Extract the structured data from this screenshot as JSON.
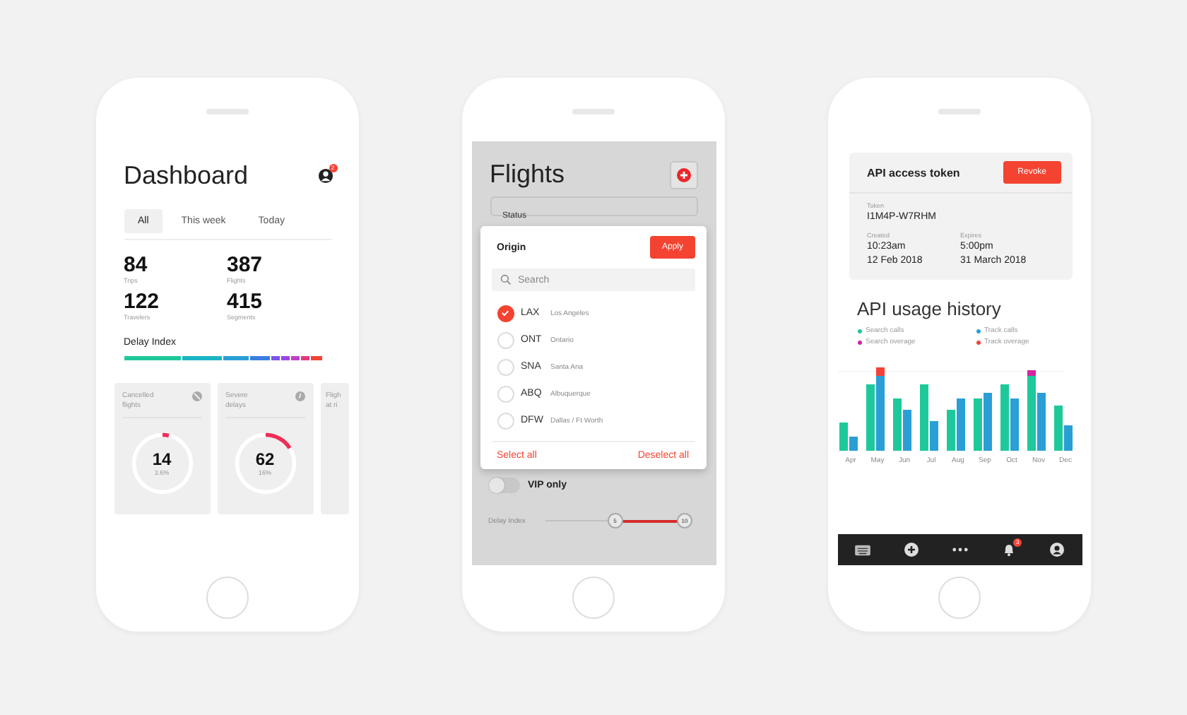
{
  "dashboard": {
    "title": "Dashboard",
    "notification_badge": "2",
    "tabs": [
      {
        "label": "All",
        "selected": true
      },
      {
        "label": "This week",
        "selected": false
      },
      {
        "label": "Today",
        "selected": false
      }
    ],
    "stats": [
      {
        "value": "84",
        "label": "Trips"
      },
      {
        "value": "387",
        "label": "Flights"
      },
      {
        "value": "122",
        "label": "Travelers"
      },
      {
        "value": "415",
        "label": "Segments"
      }
    ],
    "delay_index": {
      "label": "Delay Index",
      "segments": [
        {
          "color": "#1dc99a"
        },
        {
          "color": "#1ab5c6"
        },
        {
          "color": "#2a9fd6"
        },
        {
          "color": "#3a7fe0"
        },
        {
          "color": "#7a55e6"
        },
        {
          "color": "#9b45e2"
        },
        {
          "color": "#c13fc8"
        },
        {
          "color": "#e23a7a"
        },
        {
          "color": "#f44336"
        }
      ]
    },
    "cards": [
      {
        "kind": "ring",
        "label": "Cancelled flights",
        "value": "14",
        "percent": "3.6%",
        "level": 0.036
      },
      {
        "kind": "ring",
        "label": "Severe delays",
        "value": "62",
        "percent": "16%",
        "level": 0.16
      },
      {
        "kind": "partial",
        "label": "Fligh at ri"
      }
    ]
  },
  "flights": {
    "title": "Flights",
    "status_field": "Status",
    "origin_dialog": {
      "title": "Origin",
      "apply_button": "Apply",
      "search": {
        "placeholder": "Search"
      },
      "options": [
        {
          "code": "LAX",
          "city": "Los Angeles",
          "checked": true
        },
        {
          "code": "ONT",
          "city": "Ontario",
          "checked": false
        },
        {
          "code": "SNA",
          "city": "Santa Ana",
          "checked": false
        },
        {
          "code": "ABQ",
          "city": "Albuquerque",
          "checked": false
        },
        {
          "code": "DFW",
          "city": "Dallas / Ft Worth",
          "checked": false
        }
      ],
      "select_all": "Select all",
      "deselect_all": "Deselect all"
    },
    "vip_toggle": {
      "label": "VIP only",
      "on": false
    },
    "delay_slider": {
      "label": "Delay Index",
      "thumbs": [
        {
          "label": "5",
          "level": 0.5
        },
        {
          "label": "10",
          "level": 1
        }
      ]
    }
  },
  "api": {
    "token_card": {
      "title": "API access token",
      "revoke_button": "Revoke",
      "token_label": "Token",
      "token": "I1M4P-W7RHM",
      "created_label": "Created",
      "created_time": "10:23am",
      "created_date": "12 Feb 2018",
      "expires_label": "Expires",
      "expires_time": "5:00pm",
      "expires_date": "31 March 2018"
    },
    "usage_title": "API usage history",
    "legend": [
      {
        "label": "Search calls",
        "color": "#1dc99a"
      },
      {
        "label": "Track calls",
        "color": "#2a9fd6"
      },
      {
        "label": "Search overage",
        "color": "#d6249f"
      },
      {
        "label": "Track overage",
        "color": "#f44336"
      }
    ],
    "months": [
      "Apr",
      "May",
      "Jun",
      "Jul",
      "Aug",
      "Sep",
      "Oct",
      "Nov",
      "Dec"
    ],
    "nav_badge": "3"
  }
}
